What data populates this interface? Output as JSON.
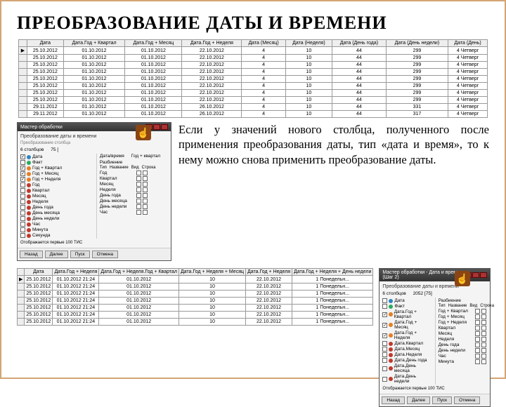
{
  "title": "ПРЕОБРАЗОВАНИЕ ДАТЫ И ВРЕМЕНИ",
  "paragraph": "Если у значений нового столбца, полученного после применения преобразования даты, тип «дата и время», то к нему можно снова применить преобразование даты.",
  "top_table": {
    "headers": [
      "",
      "Дата",
      "Дата.Год + Квартал",
      "Дата.Год + Месяц",
      "Дата.Год + Неделя",
      "Дата (Месяц)",
      "Дата (Неделя)",
      "Дата (День года)",
      "Дата (День недели)",
      "Дата (День)"
    ],
    "rows": [
      [
        "▶",
        "25.10.2012",
        "01.10.2012",
        "01.10.2012",
        "22.10.2012",
        "4",
        "10",
        "44",
        "299",
        "4 Четверг"
      ],
      [
        "",
        "25.10.2012",
        "01.10.2012",
        "01.10.2012",
        "22.10.2012",
        "4",
        "10",
        "44",
        "299",
        "4 Четверг"
      ],
      [
        "",
        "25.10.2012",
        "01.10.2012",
        "01.10.2012",
        "22.10.2012",
        "4",
        "10",
        "44",
        "299",
        "4 Четверг"
      ],
      [
        "",
        "25.10.2012",
        "01.10.2012",
        "01.10.2012",
        "22.10.2012",
        "4",
        "10",
        "44",
        "299",
        "4 Четверг"
      ],
      [
        "",
        "25.10.2012",
        "01.10.2012",
        "01.10.2012",
        "22.10.2012",
        "4",
        "10",
        "44",
        "299",
        "4 Четверг"
      ],
      [
        "",
        "25.10.2012",
        "01.10.2012",
        "01.10.2012",
        "22.10.2012",
        "4",
        "10",
        "44",
        "299",
        "4 Четверг"
      ],
      [
        "",
        "25.10.2012",
        "01.10.2012",
        "01.10.2012",
        "22.10.2012",
        "4",
        "10",
        "44",
        "299",
        "4 Четверг"
      ],
      [
        "",
        "25.10.2012",
        "01.10.2012",
        "01.10.2012",
        "22.10.2012",
        "4",
        "10",
        "44",
        "299",
        "4 Четверг"
      ],
      [
        "",
        "29.11.2012",
        "01.10.2012",
        "01.10.2012",
        "26.10.2012",
        "4",
        "10",
        "44",
        "331",
        "4 Четверг"
      ],
      [
        "",
        "29.11.2012",
        "01.10.2012",
        "01.10.2012",
        "26.10.2012",
        "4",
        "10",
        "44",
        "317",
        "4 Четверг"
      ]
    ]
  },
  "dialog1": {
    "title": "Мастер обработки",
    "subtitle": "Преобразование даты и времени",
    "hint": "Преобразование столбца",
    "left_fields": [
      {
        "name": "Дата",
        "checked": true,
        "color": "b-blue"
      },
      {
        "name": "Факт",
        "checked": false,
        "color": "b-green"
      },
      {
        "name": "Год + Квартал",
        "checked": true,
        "color": "b-orange"
      },
      {
        "name": "Год + Месяц",
        "checked": true,
        "color": "b-orange"
      },
      {
        "name": "Год + Неделя",
        "checked": true,
        "color": "b-orange"
      },
      {
        "name": "Год",
        "checked": false,
        "color": "b-red"
      },
      {
        "name": "Квартал",
        "checked": false,
        "color": "b-red"
      },
      {
        "name": "Месяц",
        "checked": false,
        "color": "b-red"
      },
      {
        "name": "Неделя",
        "checked": false,
        "color": "b-red"
      },
      {
        "name": "День года",
        "checked": false,
        "color": "b-red"
      },
      {
        "name": "День месяца",
        "checked": false,
        "color": "b-red"
      },
      {
        "name": "День недели",
        "checked": false,
        "color": "b-red"
      },
      {
        "name": "Час",
        "checked": false,
        "color": "b-red"
      },
      {
        "name": "Минута",
        "checked": false,
        "color": "b-red"
      },
      {
        "name": "Секунда",
        "checked": false,
        "color": "b-red"
      }
    ],
    "right": {
      "col_label": "6 столбцов",
      "rows_label": "75 [",
      "cat1": "Дата/время",
      "cat2": "Год + квартал",
      "section": "Разбиение",
      "type_lbl": "Тип",
      "name_lbl": "Название",
      "kind_lbl": "Вид",
      "string_lbl": "Строка",
      "items": [
        "Год",
        "Квартал",
        "Месяц",
        "Неделя",
        "День года",
        "День месяца",
        "День недели",
        "Час"
      ]
    },
    "footer_hint": "Отображается первые 100 ТИС",
    "buttons": [
      "Назад",
      "Далее",
      "Пуск",
      "Отмена"
    ]
  },
  "bottom_table": {
    "headers": [
      "",
      "Дата",
      "Дата.Год + Неделя",
      "Дата.Год + Неделя.Год + Квартал",
      "Дата.Год + Неделя + Месяц",
      "Дата.Год + Неделя",
      "Дата.Год + Неделя + День недели"
    ],
    "rows": [
      [
        "▶",
        "25.10.2012",
        "01.10.2012 21:24",
        "01.10.2012",
        "10",
        "22.10.2012",
        "1 Понедельн..."
      ],
      [
        "",
        "25.10.2012",
        "01.10.2012 21:24",
        "01.10.2012",
        "10",
        "22.10.2012",
        "1 Понедельн..."
      ],
      [
        "",
        "25.10.2012",
        "01.10.2012 21:24",
        "01.10.2012",
        "10",
        "22.10.2012",
        "1 Понедельн..."
      ],
      [
        "",
        "25.10.2012",
        "01.10.2012 21:24",
        "01.10.2012",
        "10",
        "22.10.2012",
        "1 Понедельн..."
      ],
      [
        "",
        "25.10.2012",
        "01.10.2012 21:24",
        "01.10.2012",
        "10",
        "22.10.2012",
        "1 Понедельн..."
      ],
      [
        "",
        "25.10.2012",
        "01.10.2012 21:24",
        "01.10.2012",
        "10",
        "22.10.2012",
        "1 Понедельн..."
      ],
      [
        "",
        "25.10.2012",
        "01.10.2012 21:24",
        "01.10.2012",
        "10",
        "22.10.2012",
        "1 Понедельн..."
      ]
    ]
  },
  "dialog2": {
    "title": "Мастер обработки - Дата и время (Шаг 2)",
    "subtitle": "Преобразование даты и времени",
    "left_fields": [
      {
        "name": "Дата",
        "checked": false,
        "color": "b-blue"
      },
      {
        "name": "Факт",
        "checked": false,
        "color": "b-green"
      },
      {
        "name": "Дата.Год + Квартал",
        "checked": true,
        "color": "b-orange"
      },
      {
        "name": "Дата.Год + Месяц",
        "checked": true,
        "color": "b-orange"
      },
      {
        "name": "Дата.Год + Неделя",
        "checked": true,
        "color": "b-orange"
      },
      {
        "name": "Дата.Квартал",
        "checked": false,
        "color": "b-red"
      },
      {
        "name": "Дата.Месяц",
        "checked": false,
        "color": "b-red"
      },
      {
        "name": "Дата.Неделя",
        "checked": false,
        "color": "b-red"
      },
      {
        "name": "Дата.День года",
        "checked": false,
        "color": "b-red"
      },
      {
        "name": "Дата.День месяца",
        "checked": false,
        "color": "b-red"
      },
      {
        "name": "Дата.День недели",
        "checked": false,
        "color": "b-red"
      }
    ],
    "right": {
      "col_label": "6 столбцов",
      "rows_label": "2052 [75]",
      "section": "Разбиение",
      "type_lbl": "Тип",
      "name_lbl": "Название",
      "kind_lbl": "Вид",
      "string_lbl": "Строка",
      "items": [
        "Год + Квартал",
        "Год + Месяц",
        "Год + Неделя",
        "Квартал",
        "Месяц",
        "Неделя",
        "День года",
        "День недели",
        "Час",
        "Минута"
      ]
    },
    "footer_hint": "Отображается первые 100 ТИС",
    "buttons": [
      "Назад",
      "Далее",
      "Пуск",
      "Отмена"
    ]
  }
}
